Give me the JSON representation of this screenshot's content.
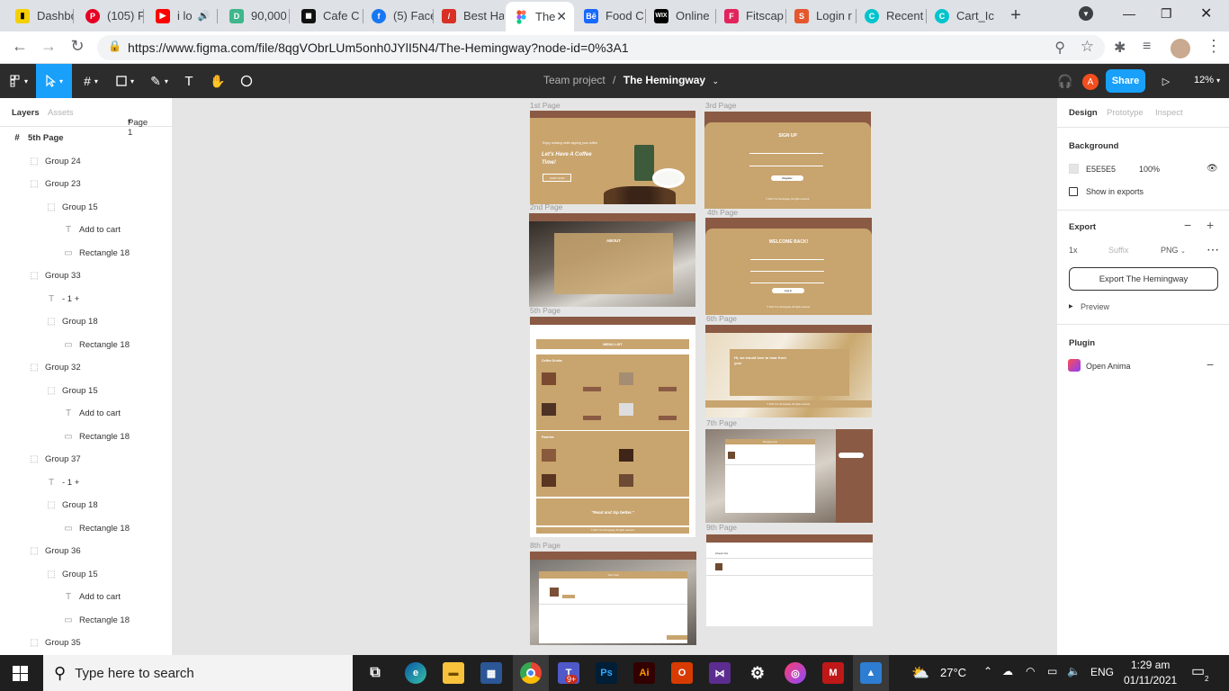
{
  "browser": {
    "tabs": [
      {
        "label": "Dashbo",
        "icon": "dashboard-favicon",
        "color": "#f5d000"
      },
      {
        "label": "(105) P",
        "icon": "pinterest-favicon",
        "color": "#e60023"
      },
      {
        "label": "i lo",
        "icon": "youtube-favicon",
        "color": "#ff0000"
      },
      {
        "label": "90,000",
        "icon": "d-favicon",
        "color": "#3fb68b"
      },
      {
        "label": "Cafe C",
        "icon": "cafe-favicon",
        "color": "#111111"
      },
      {
        "label": "(5) Face",
        "icon": "facebook-favicon",
        "color": "#1877f2"
      },
      {
        "label": "Best Ha",
        "icon": "bestha-favicon",
        "color": "#d93025"
      },
      {
        "label": "The",
        "icon": "figma-favicon",
        "color": "#f24e1e",
        "active": true
      },
      {
        "label": "Food C",
        "icon": "behance-favicon",
        "color": "#1769ff"
      },
      {
        "label": "Online",
        "icon": "wix-favicon",
        "color": "#000000"
      },
      {
        "label": "Fitscap",
        "icon": "fitscap-favicon",
        "color": "#e2245c"
      },
      {
        "label": "Login r",
        "icon": "login-favicon",
        "color": "#e4572e"
      },
      {
        "label": "Recent",
        "icon": "canva-favicon",
        "color": "#00c4cc"
      },
      {
        "label": "Cart_Ic",
        "icon": "canva-favicon",
        "color": "#00c4cc"
      }
    ],
    "url": "https://www.figma.com/file/8qgVObrLUm5onh0JYlI5N4/The-Hemingway?node-id=0%3A1"
  },
  "figma": {
    "breadcrumb_team": "Team project",
    "breadcrumb_sep": "/",
    "file_name": "The Hemingway",
    "avatar_initial": "A",
    "share_label": "Share",
    "zoom_label": "12%",
    "left_panel": {
      "tab_layers": "Layers",
      "tab_assets": "Assets",
      "page_selector": "Page 1",
      "layers": [
        {
          "name": "5th Page",
          "icon": "frame-icon",
          "indent": 0
        },
        {
          "name": "Group 24",
          "icon": "group-icon",
          "indent": 1
        },
        {
          "name": "Group 23",
          "icon": "group-icon",
          "indent": 1
        },
        {
          "name": "Group 15",
          "icon": "group-icon",
          "indent": 2
        },
        {
          "name": "Add to cart",
          "icon": "text-icon",
          "indent": 3
        },
        {
          "name": "Rectangle 18",
          "icon": "rectangle-icon",
          "indent": 3
        },
        {
          "name": "Group 33",
          "icon": "group-icon",
          "indent": 1
        },
        {
          "name": "- 1 +",
          "icon": "text-icon",
          "indent": 2
        },
        {
          "name": "Group 18",
          "icon": "group-icon",
          "indent": 2
        },
        {
          "name": "Rectangle 18",
          "icon": "rectangle-icon",
          "indent": 3
        },
        {
          "name": "Group 32",
          "icon": "group-icon",
          "indent": 1
        },
        {
          "name": "Group 15",
          "icon": "group-icon",
          "indent": 2
        },
        {
          "name": "Add to cart",
          "icon": "text-icon",
          "indent": 3
        },
        {
          "name": "Rectangle 18",
          "icon": "rectangle-icon",
          "indent": 3
        },
        {
          "name": "Group 37",
          "icon": "group-icon",
          "indent": 1
        },
        {
          "name": "- 1 +",
          "icon": "text-icon",
          "indent": 2
        },
        {
          "name": "Group 18",
          "icon": "group-icon",
          "indent": 2
        },
        {
          "name": "Rectangle 18",
          "icon": "rectangle-icon",
          "indent": 3
        },
        {
          "name": "Group 36",
          "icon": "group-icon",
          "indent": 1
        },
        {
          "name": "Group 15",
          "icon": "group-icon",
          "indent": 2
        },
        {
          "name": "Add to cart",
          "icon": "text-icon",
          "indent": 3
        },
        {
          "name": "Rectangle 18",
          "icon": "rectangle-icon",
          "indent": 3
        },
        {
          "name": "Group 35",
          "icon": "group-icon",
          "indent": 1
        }
      ]
    },
    "canvas": {
      "background": "#E5E5E5",
      "frames": [
        {
          "label": "1st Page",
          "headline": "Let's Have A Coffee Time!",
          "tagline": "Enjoy relaxing while sipping your coffee",
          "button": "SHOP NOW"
        },
        {
          "label": "2nd Page",
          "heading": "ABOUT"
        },
        {
          "label": "3rd Page",
          "heading": "SIGN UP",
          "button": "Register",
          "footer": "© 2021 The Hemingway. All rights reserved."
        },
        {
          "label": "4th Page",
          "heading": "WELCOME BACK!",
          "button": "Log in",
          "footer": "© 2021 The Hemingway. All rights reserved."
        },
        {
          "label": "5th Page",
          "heading": "MENU LIST",
          "section1": "Coffee Drinks",
          "section2": "Pastries",
          "quote": "\"Read and Sip better.\"",
          "footer": "© 2021 The Hemingway. All rights reserved."
        },
        {
          "label": "6th Page",
          "heading": "Hi, we would love to hear from you!",
          "footer": "© 2021 The Hemingway. All rights reserved."
        },
        {
          "label": "7th Page",
          "heading": "Shopping Cart"
        },
        {
          "label": "8th Page",
          "heading": "Your Cart"
        },
        {
          "label": "9th Page",
          "heading": "Check Out"
        }
      ]
    },
    "right_panel": {
      "tab_design": "Design",
      "tab_prototype": "Prototype",
      "tab_inspect": "Inspect",
      "background_heading": "Background",
      "background_hex": "E5E5E5",
      "background_opacity": "100%",
      "show_in_exports": "Show in exports",
      "export_heading": "Export",
      "export_scale": "1x",
      "export_suffix_placeholder": "Suffix",
      "export_format": "PNG",
      "export_button": "Export The Hemingway",
      "preview_label": "Preview",
      "plugin_heading": "Plugin",
      "plugin_name": "Open Anima"
    },
    "help_label": "?"
  },
  "taskbar": {
    "search_placeholder": "Type here to search",
    "temperature": "27°C",
    "language": "ENG",
    "time": "1:29 am",
    "date": "01/11/2021",
    "notifications": "2",
    "teams_badge": "9+"
  },
  "colors": {
    "figma_blue": "#18a0fb",
    "coffee_tan": "#c8a46e",
    "coffee_brown": "#8a5a44"
  }
}
